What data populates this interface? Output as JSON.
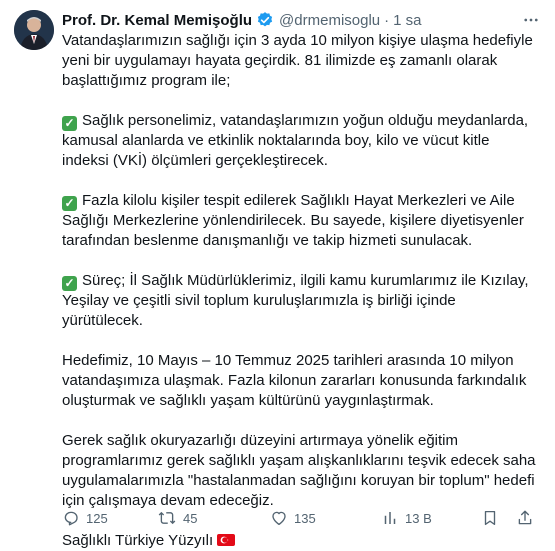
{
  "author": {
    "name": "Prof. Dr. Kemal Memişoğlu",
    "handle": "@drmemisoglu",
    "separator": "·",
    "time": "1 sa"
  },
  "tweet": {
    "p1": "Vatandaşlarımızın sağlığı için 3 ayda 10 milyon kişiye ulaşma hedefiyle yeni bir uygulamayı hayata geçirdik. 81 ilimizde eş zamanlı olarak başlattığımız program ile;",
    "p2": "Sağlık personelimiz, vatandaşlarımızın yoğun olduğu meydanlarda, kamusal alanlarda ve etkinlik noktalarında boy, kilo ve vücut kitle indeksi (VKİ) ölçümleri gerçekleştirecek.",
    "p3": "Fazla kilolu kişiler tespit edilerek Sağlıklı Hayat Merkezleri ve Aile Sağlığı Merkezlerine yönlendirilecek. Bu sayede, kişilere diyetisyenler tarafından beslenme danışmanlığı ve takip hizmeti sunulacak.",
    "p4": "Süreç; İl Sağlık Müdürlüklerimiz, ilgili kamu kurumlarımız ile Kızılay, Yeşilay ve çeşitli sivil toplum kuruluşlarımızla iş birliği içinde yürütülecek.",
    "p5": "Hedefimiz, 10 Mayıs – 10 Temmuz 2025 tarihleri arasında 10 milyon vatandaşımıza ulaşmak. Fazla kilonun zararları konusunda farkındalık oluşturmak ve sağlıklı yaşam kültürünü yaygınlaştırmak.",
    "p6": "Gerek sağlık okuryazarlığı düzeyini artırmaya yönelik eğitim programlarımız gerek sağlıklı yaşam alışkanlıklarını teşvik edecek saha uygulamalarımızla \"hastalanmadan sağlığını koruyan bir toplum\" hedefi için çalışmaya devam edeceğiz.",
    "p7": "Sağlıklı Türkiye Yüzyılı"
  },
  "actions": {
    "replies": "125",
    "reposts": "45",
    "likes": "135",
    "views": "13 B"
  },
  "icons": {
    "verified": "verified-badge-icon",
    "more": "more-icon",
    "check": "check-mark-emoji",
    "flag": "turkey-flag-emoji",
    "reply": "reply-icon",
    "repost": "repost-icon",
    "like": "heart-icon",
    "views": "views-icon",
    "bookmark": "bookmark-icon",
    "share": "share-icon"
  },
  "colors": {
    "verified": "#1d9bf0",
    "text": "#0f1419",
    "secondary": "#536471",
    "check": "#3fa34d",
    "flag": "#e30a17"
  }
}
